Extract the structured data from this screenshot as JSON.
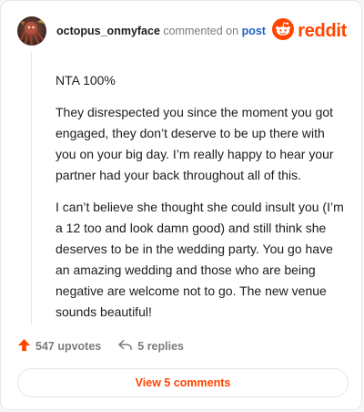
{
  "comment": {
    "author": "octopus_onmyface",
    "action_text": "commented on",
    "post_link_label": "post",
    "paragraphs": [
      "NTA 100%",
      "They disrespected you since the moment you got engaged, they don’t deserve to be up there with you on your big day. I’m really happy to hear your partner had your back throughout all of this.",
      "I can’t believe she thought she could insult you (I’m a 12 too and look damn good) and still think she deserves to be in the wedding party. You go have an amazing wedding and those who are being negative are welcome not to go. The new venue sounds beautiful!"
    ],
    "upvotes_label": "547 upvotes",
    "replies_label": "5 replies"
  },
  "brand": {
    "wordmark": "reddit",
    "color": "#ff4500"
  },
  "footer": {
    "view_comments_label": "View 5 comments"
  },
  "icons": {
    "avatar": "user-avatar",
    "logo": "reddit-logo-icon",
    "upvote": "upvote-arrow-icon",
    "reply": "reply-arrow-icon"
  },
  "colors": {
    "accent": "#ff4500",
    "link": "#1f63c6",
    "muted": "#7c7c7c",
    "text": "#1c1c1c"
  }
}
